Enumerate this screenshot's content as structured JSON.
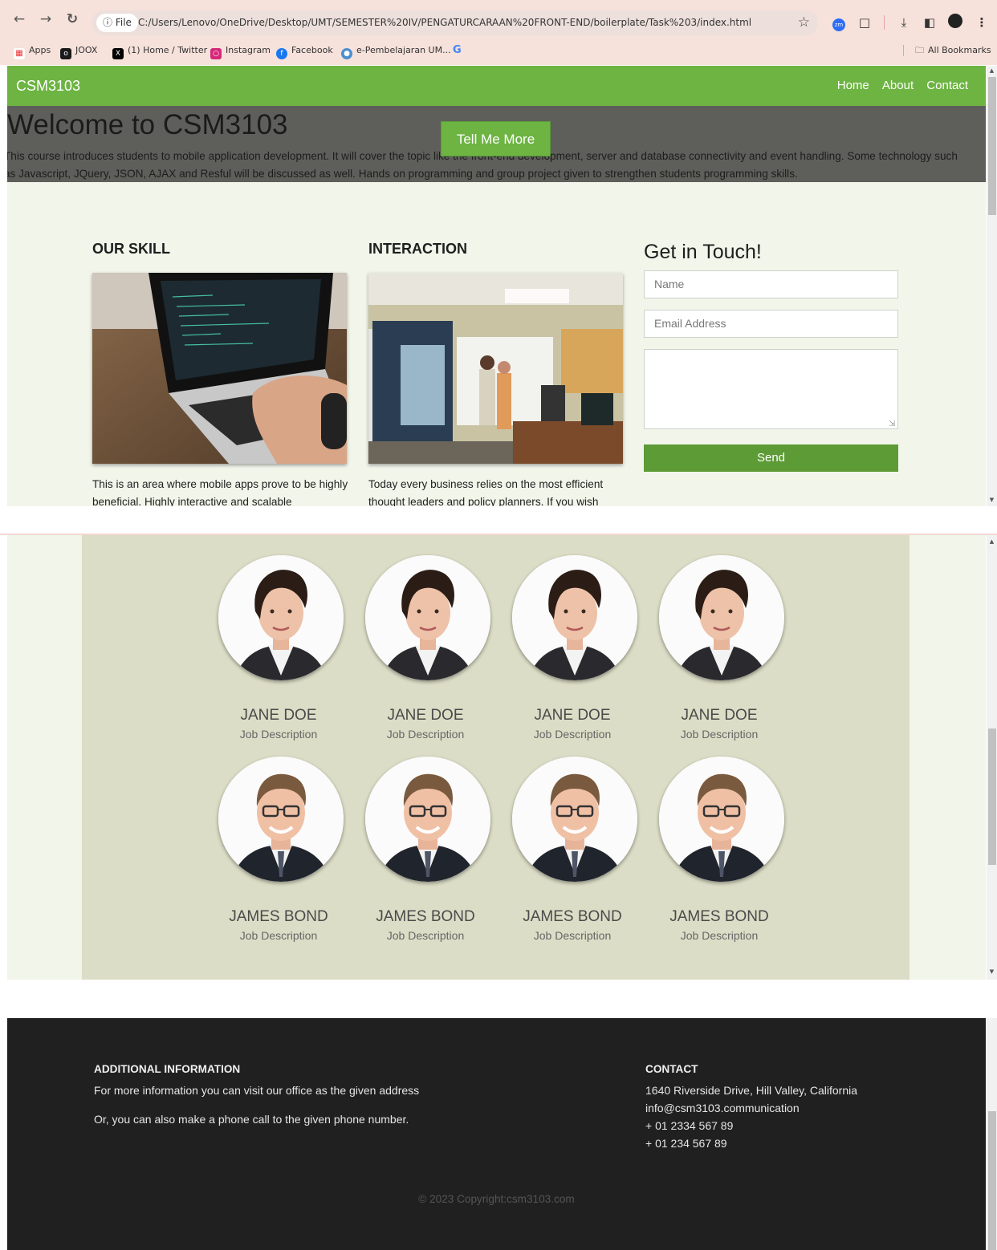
{
  "browser": {
    "site_info": "File",
    "url": "C:/Users/Lenovo/OneDrive/Desktop/UMT/SEMESTER%20IV/PENGATURCARAAN%20FRONT-END/boilerplate/Task%203/index.html",
    "bookmarks": [
      "Apps",
      "JOOX",
      "(1) Home / Twitter",
      "Instagram",
      "Facebook",
      "e-Pembelajaran UM...",
      "G"
    ],
    "all_bookmarks": "All Bookmarks"
  },
  "navbar": {
    "brand": "CSM3103",
    "links": [
      "Home",
      "About",
      "Contact"
    ]
  },
  "hero": {
    "title": "Welcome to CSM3103",
    "text": "This course introduces students to mobile application development. It will cover the topic like the front-end development, server and database connectivity and event handling. Some technology such as Javascript, JQuery, JSON, AJAX and Resful will be discussed as well. Hands on programming and group project given to strengthen students programming skills.",
    "button": "Tell Me More"
  },
  "skill": {
    "title": "OUR SKILL",
    "text": "This is an area where mobile apps prove to be highly beneficial. Highly interactive and scalable"
  },
  "interaction": {
    "title": "INTERACTION",
    "text": "Today every business relies on the most efficient thought leaders and policy planners. If you wish"
  },
  "contact_form": {
    "title": "Get in Touch!",
    "name_placeholder": "Name",
    "email_placeholder": "Email Address",
    "message_placeholder": "",
    "send": "Send"
  },
  "team": [
    {
      "name": "JANE DOE",
      "job": "Job Description"
    },
    {
      "name": "JANE DOE",
      "job": "Job Description"
    },
    {
      "name": "JANE DOE",
      "job": "Job Description"
    },
    {
      "name": "JANE DOE",
      "job": "Job Description"
    },
    {
      "name": "JAMES BOND",
      "job": "Job Description"
    },
    {
      "name": "JAMES BOND",
      "job": "Job Description"
    },
    {
      "name": "JAMES BOND",
      "job": "Job Description"
    },
    {
      "name": "JAMES BOND",
      "job": "Job Description"
    }
  ],
  "footer": {
    "info_title": "ADDITIONAL INFORMATION",
    "info_line1": "For more information you can visit our office as the given address",
    "info_line2": "Or, you can also make a phone call to the given phone number.",
    "contact_title": "CONTACT",
    "address": "1640 Riverside Drive, Hill Valley, California",
    "email": "info@csm3103.communication",
    "phone1": "+ 01 2334 567 89",
    "phone2": "+ 01 234 567 89",
    "copyright": "© 2023 Copyright:csm3103.com"
  },
  "colors": {
    "accent": "#6db442",
    "footer_bg": "#202020",
    "team_bg": "#dcddc6",
    "page_bg": "#f1f5ea"
  }
}
